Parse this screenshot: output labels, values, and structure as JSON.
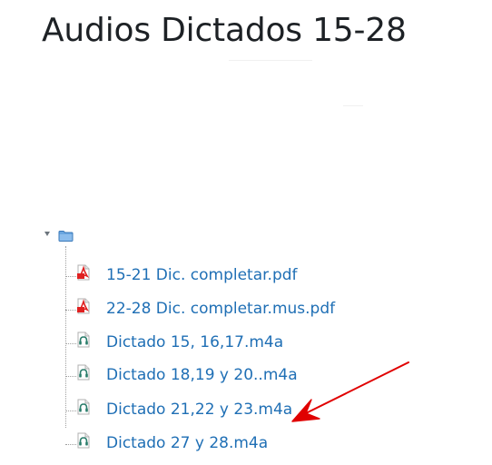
{
  "page": {
    "title": "Audios Dictados 15-28"
  },
  "folder": {
    "icon": "folder-icon",
    "files": [
      {
        "name": "15-21 Dic. completar.pdf",
        "icon": "pdf-icon"
      },
      {
        "name": "22-28 Dic. completar.mus.pdf",
        "icon": "pdf-icon"
      },
      {
        "name": "Dictado 15, 16,17.m4a",
        "icon": "audio-icon"
      },
      {
        "name": "Dictado 18,19 y 20..m4a",
        "icon": "audio-icon"
      },
      {
        "name": "Dictado 21,22 y 23.m4a",
        "icon": "audio-icon"
      },
      {
        "name": "Dictado 27 y 28.m4a",
        "icon": "audio-icon"
      }
    ]
  },
  "colors": {
    "link": "#1f6fb5",
    "title": "#1d2125",
    "pdf_red": "#e02020",
    "audio_teal": "#2a7d6b",
    "arrow_red": "#e00000"
  }
}
